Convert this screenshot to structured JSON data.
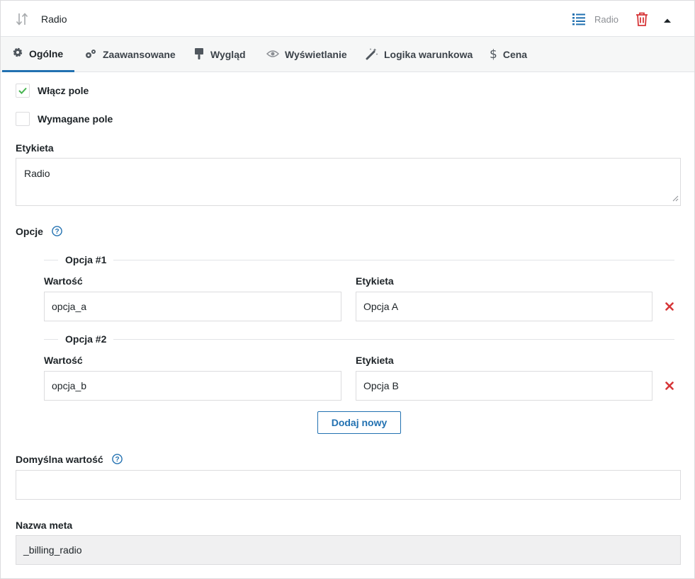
{
  "header": {
    "title": "Radio",
    "type_label": "Radio",
    "icons": {
      "sort": "sort-arrows-icon",
      "type": "list-icon",
      "delete": "trash-icon",
      "collapse": "caret-up-icon"
    },
    "colors": {
      "type_icon": "#2271b1",
      "delete_icon": "#d63638"
    }
  },
  "tabs": [
    {
      "label": "Ogólne",
      "icon": "gear-icon",
      "active": true
    },
    {
      "label": "Zaawansowane",
      "icon": "gears-icon",
      "active": false
    },
    {
      "label": "Wygląd",
      "icon": "paint-brush-icon",
      "active": false
    },
    {
      "label": "Wyświetlanie",
      "icon": "eye-icon",
      "active": false
    },
    {
      "label": "Logika warunkowa",
      "icon": "magic-wand-icon",
      "active": false
    },
    {
      "label": "Cena",
      "icon": "dollar-icon",
      "active": false
    }
  ],
  "general": {
    "enable_field": {
      "label": "Włącz pole",
      "checked": true
    },
    "required_field": {
      "label": "Wymagane pole",
      "checked": false
    },
    "label_field": {
      "label": "Etykieta",
      "value": "Radio"
    },
    "options": {
      "label": "Opcje",
      "items": [
        {
          "legend": "Opcja #1",
          "value_label": "Wartość",
          "value": "opcja_a",
          "label_label": "Etykieta",
          "label": "Opcja A"
        },
        {
          "legend": "Opcja #2",
          "value_label": "Wartość",
          "value": "opcja_b",
          "label_label": "Etykieta",
          "label": "Opcja B"
        }
      ],
      "add_button": "Dodaj nowy"
    },
    "default_value": {
      "label": "Domyślna wartość",
      "value": ""
    },
    "meta_name": {
      "label": "Nazwa meta",
      "value": "_billing_radio"
    }
  },
  "colors": {
    "accent": "#2271b1",
    "check": "#46b450",
    "remove": "#d63638",
    "border": "#dcdcde"
  }
}
